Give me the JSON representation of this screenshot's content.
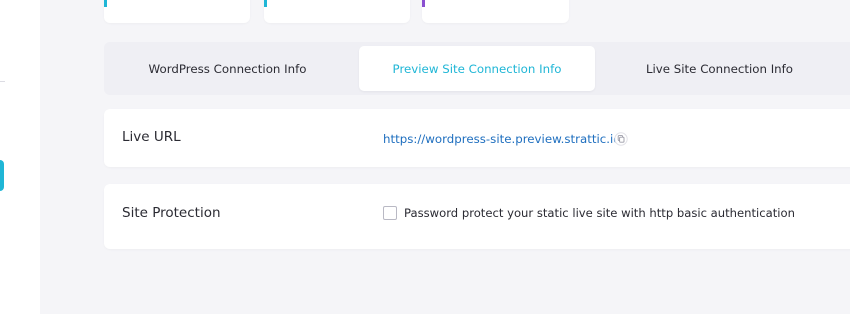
{
  "colors": {
    "page_background": "#f5f5f8",
    "card_background": "#ffffff",
    "accent_cyan": "#1fb6d6",
    "accent_purple": "#8a4fd0",
    "link_blue": "#1f6fbf"
  },
  "icons": {
    "copy": "copy-icon"
  },
  "tabs": [
    {
      "label": "WordPress Connection Info",
      "active": false
    },
    {
      "label": "Preview Site Connection Info",
      "active": true
    },
    {
      "label": "Live Site Connection Info",
      "active": false
    }
  ],
  "live_url": {
    "label": "Live URL",
    "url": "https://wordpress-site.preview.strattic.io"
  },
  "site_protection": {
    "label": "Site Protection",
    "checkbox_label": "Password protect your static live site with http basic authentication",
    "checked": false
  }
}
